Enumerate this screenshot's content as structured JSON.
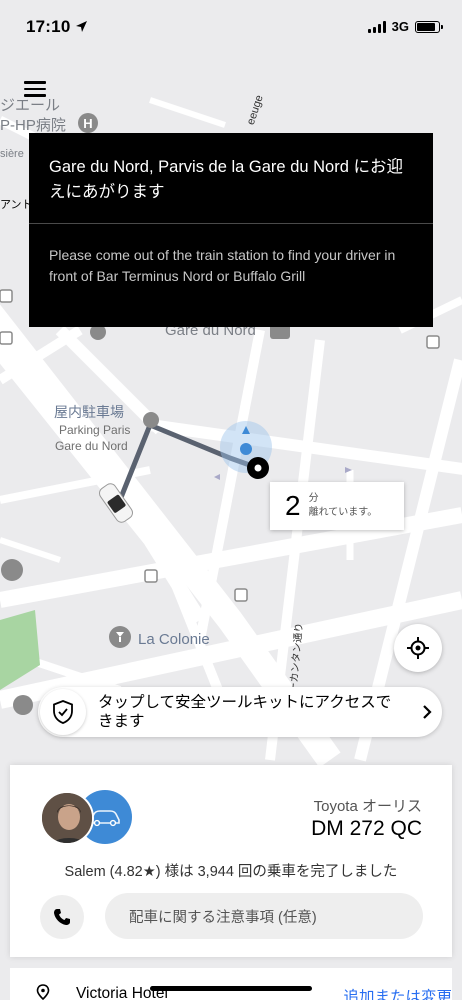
{
  "status_bar": {
    "time": "17:10",
    "network": "3G"
  },
  "map": {
    "labels": {
      "top_poi_jp": "ジエール",
      "hospital": "P-HP病院",
      "fragment_left": "sière",
      "fragment_ant": "アント",
      "street_top": "eeuge",
      "station": "Gare du Nord",
      "parking_jp": "屋内駐車場",
      "parking_fr_1": "Parking Paris",
      "parking_fr_2": "Gare du Nord",
      "la_colonie": "La Colonie",
      "street_vertical": "ーカンタン通り"
    }
  },
  "pickup": {
    "title": "Gare du Nord, Parvis de la Gare du Nord にお迎えにあがります",
    "note": "Please come out of the train station to find your driver in front of Bar Terminus Nord or Buffalo Grill"
  },
  "eta": {
    "minutes": "2",
    "unit_line1": "分",
    "unit_line2": "離れています。"
  },
  "safety": {
    "text": "タップして安全ツールキットにアクセスできます"
  },
  "driver": {
    "car_model": "Toyota オーリス",
    "plate": "DM 272 QC",
    "summary": "Salem (4.82★) 様は 3,944 回の乗車を完了しました",
    "note_placeholder": "配車に関する注意事項 (任意)"
  },
  "destination": {
    "name": "Victoria Hotel",
    "change_label": "追加または変更"
  },
  "colors": {
    "route": "#5a6270",
    "accent_blue": "#3e8ad6",
    "link_blue": "#276ef1",
    "park_green": "#a8d5a2"
  }
}
